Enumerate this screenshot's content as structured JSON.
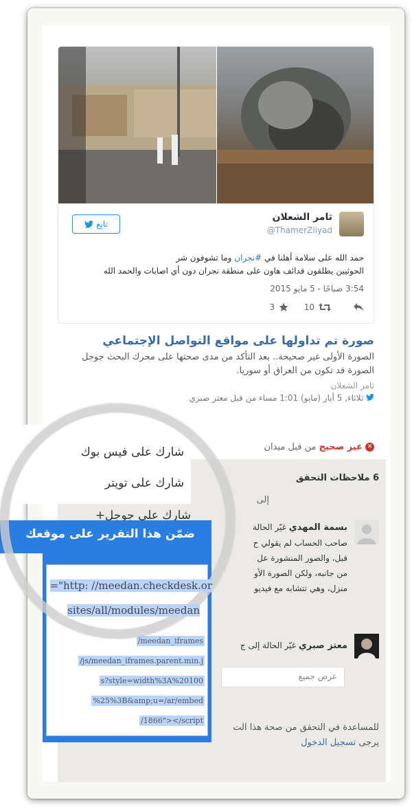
{
  "tweet": {
    "name": "ثامر الشعلان",
    "handle": "@ThamerZiiyad",
    "follow_label": "تابِع",
    "text_line1_pre": "حمد الله  على سلامة أهلنا في ",
    "hashtag": "#نجران",
    "text_line1_post": " وما تشوفون شر",
    "text_line2": "الحوثيين يطلقون قدائف هاون على منطقة نجران دون أي اصابات والحمد الله",
    "date": "3:54 صباحًا - 5 مايو 2015",
    "retweets": "10",
    "likes": "3"
  },
  "report": {
    "title": "صورة تم تداولها على مواقع التواصل الإجتماعي",
    "description": "الصورة الأولى غير صحيحة.. بعد التأكد من مدى صحتها على محرك البحث جوجل الصورة قد تكون من العراق أو سوريا.",
    "author": "ثامر الشعلان",
    "meta": "ثلاثاء, 5 أيار (مايو) 1:01 مساء من قبل معتز صبري"
  },
  "status": {
    "label": "غير صحيح",
    "by": "من قبل ميدان"
  },
  "notes": {
    "heading": "6 ملاحظات التحقق",
    "top_fragment": "إلى",
    "note1_name": "بسمة المهدي",
    "note1_action": "غيّر الحالة",
    "note1_text": "صاحب الحساب لم يقولي ح",
    "note1_text2": "قبل، والصور المنشورة عل",
    "note1_text3": "من جانبه، ولكن الصورة الأو",
    "note1_text4": "منزل، وهي تتشابه مع فيديو",
    "note2_name": "معتز صبري",
    "note2_action": "غيّر الحالة إلى ج",
    "show_all": "عرض جميع",
    "help_text": "للمساعدة في التحقق من صحة هذا الت",
    "login_prefix": "يرجى",
    "login_link": "تسجيل الدخول"
  },
  "menu": {
    "share_facebook": "شارك على فيس بوك",
    "share_twitter": "شارك على تويتر",
    "share_google": "شارك على جوجل+",
    "embed": "ضمّن هذا التقرير على موقعك"
  },
  "embed_code": {
    "lens_line1": "=\"http: //meedan.checkdesk.or",
    "lens_line2": "sites/all/modules/meedan",
    "lines": [
      "/meedan_iframes",
      "/js/meedan_iframes.parent.min.j",
      "s?style=width%3A%20100",
      "%25%3B&amp;u=/ar/embed",
      "/1866\"></script"
    ]
  }
}
